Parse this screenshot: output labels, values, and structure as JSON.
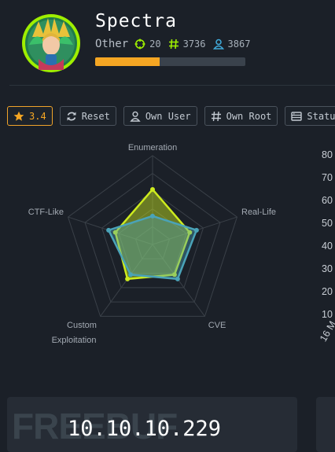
{
  "machine": {
    "name": "Spectra",
    "os": "Other",
    "points": "20",
    "flags": "3736",
    "users": "3867",
    "progress": 0.43,
    "ip": "10.10.10.229"
  },
  "toolbar": {
    "rating": "3.4",
    "reset": "Reset",
    "own_user": "Own User",
    "own_root": "Own Root",
    "status": "Status"
  },
  "radar": {
    "axes": [
      "Enumeration",
      "Real-Life",
      "CVE",
      "Custom Exploitation",
      "CTF-Like"
    ],
    "axis_labels": {
      "enumeration": "Enumeration",
      "real_life": "Real-Life",
      "cve": "CVE",
      "custom_line1": "Custom",
      "custom_line2": "Exploitation",
      "ctf_like": "CTF-Like"
    },
    "max": 5,
    "series": [
      {
        "color": "#cdeb1e",
        "values": [
          3.1,
          2.2,
          2.1,
          2.4,
          2.2
        ]
      },
      {
        "color": "#4aa3b8",
        "values": [
          1.6,
          2.6,
          2.4,
          2.1,
          2.6
        ]
      }
    ]
  },
  "chart_axis": {
    "y_ticks": [
      "80",
      "70",
      "60",
      "50",
      "40",
      "30",
      "20",
      "10"
    ],
    "x_label": "16 M"
  },
  "watermark": "FREEBUF",
  "colors": {
    "accent": "#f5a623",
    "bg": "#1b2028",
    "points": "#9fef00",
    "flags": "#9fef00",
    "users": "#40a9d8"
  }
}
